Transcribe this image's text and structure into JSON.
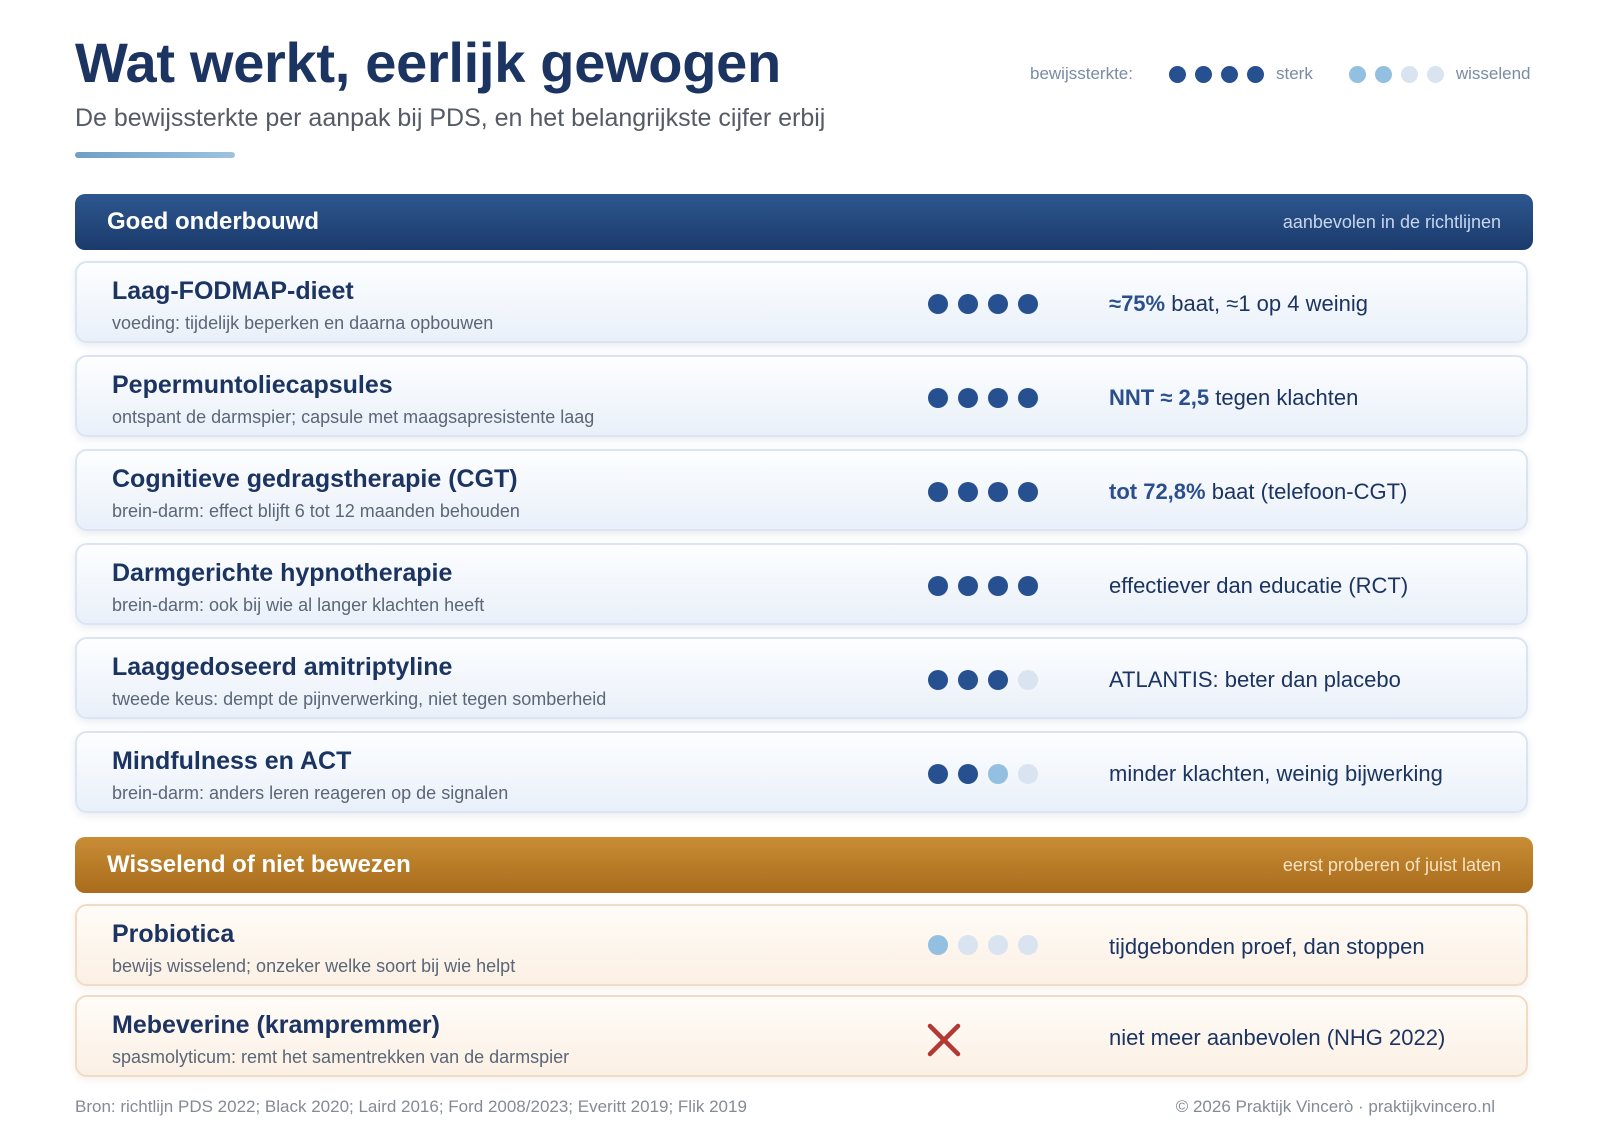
{
  "header": {
    "title": "Wat werkt, eerlijk gewogen",
    "subtitle": "De bewijssterkte per aanpak bij PDS, en het belangrijkste cijfer erbij"
  },
  "legend": {
    "label": "bewijssterkte:",
    "strong_label": "sterk",
    "mixed_label": "wisselend",
    "strong_dots": [
      "full",
      "full",
      "full",
      "full"
    ],
    "mixed_dots": [
      "mid",
      "mid",
      "empty",
      "empty"
    ]
  },
  "colors": {
    "primary": "#1c3461",
    "dot_full": "#26508f",
    "dot_mid": "#93bfe0",
    "dot_empty": "#d9e4f0",
    "amber": "#b9792a",
    "cross": "#b23a35"
  },
  "sections": [
    {
      "title": "Goed onderbouwd",
      "note": "aanbevolen in de richtlijnen",
      "theme": "blue",
      "items": [
        {
          "name": "Laag-FODMAP-dieet",
          "desc": "voeding: tijdelijk beperken en daarna opbouwen",
          "evidence": 4,
          "fact_bold": "≈75%",
          "fact_rest": " baat, ≈1 op 4 weinig"
        },
        {
          "name": "Pepermuntoliecapsules",
          "desc": "ontspant de darmspier; capsule met maagsapresistente laag",
          "evidence": 4,
          "fact_bold": "NNT ≈ 2,5",
          "fact_rest": " tegen klachten"
        },
        {
          "name": "Cognitieve gedragstherapie (CGT)",
          "desc": "brein-darm: effect blijft 6 tot 12 maanden behouden",
          "evidence": 4,
          "fact_bold": "tot 72,8%",
          "fact_rest": " baat (telefoon-CGT)"
        },
        {
          "name": "Darmgerichte hypnotherapie",
          "desc": "brein-darm: ook bij wie al langer klachten heeft",
          "evidence": 4,
          "fact_bold": "",
          "fact_rest": "effectiever dan educatie (RCT)"
        },
        {
          "name": "Laaggedoseerd amitriptyline",
          "desc": "tweede keus: dempt de pijnverwerking, niet tegen somberheid",
          "evidence": 3,
          "fact_bold": "",
          "fact_rest": "ATLANTIS: beter dan placebo"
        },
        {
          "name": "Mindfulness en ACT",
          "desc": "brein-darm: anders leren reageren op de signalen",
          "evidence": 2.5,
          "fact_bold": "",
          "fact_rest": "minder klachten, weinig bijwerking"
        }
      ]
    },
    {
      "title": "Wisselend of niet bewezen",
      "note": "eerst proberen of juist laten",
      "theme": "amber",
      "items": [
        {
          "name": "Probiotica",
          "desc": "bewijs wisselend; onzeker welke soort bij wie helpt",
          "evidence": 0.5,
          "fact_bold": "",
          "fact_rest": "tijdgebonden proef, dan stoppen"
        },
        {
          "name": "Mebeverine (krampremmer)",
          "desc": "spasmolyticum: remt het samentrekken van de darmspier",
          "evidence": "none",
          "fact_bold": "",
          "fact_rest": "niet meer aanbevolen (NHG 2022)"
        }
      ]
    }
  ],
  "footer": {
    "source": "Bron: richtlijn PDS 2022; Black 2020; Laird 2016; Ford 2008/2023; Everitt 2019; Flik 2019",
    "copyright": "© 2026 Praktijk Vincerò · praktijkvincero.nl"
  }
}
